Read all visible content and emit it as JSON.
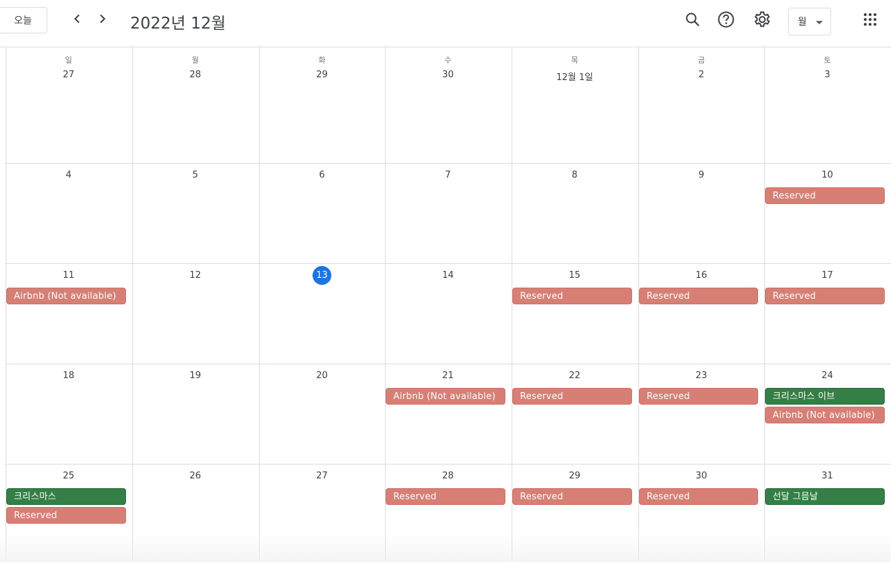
{
  "header": {
    "today_label": "오늘",
    "title": "2022년 12월",
    "view_label": "월"
  },
  "icons": {
    "prev": "chevron-left-icon",
    "next": "chevron-right-icon",
    "search": "search-icon",
    "help": "help-icon",
    "settings": "gear-icon",
    "apps": "apps-grid-icon"
  },
  "colors": {
    "reserved": "#d77f74",
    "holiday": "#337f45",
    "today": "#1a73e8"
  },
  "weekdays": [
    "일",
    "월",
    "화",
    "수",
    "목",
    "금",
    "토"
  ],
  "weeks": [
    {
      "days": [
        "27",
        "28",
        "29",
        "30",
        "12월 1일",
        "2",
        "3"
      ]
    },
    {
      "days": [
        "4",
        "5",
        "6",
        "7",
        "8",
        "9",
        "10"
      ]
    },
    {
      "days": [
        "11",
        "12",
        "13",
        "14",
        "15",
        "16",
        "17"
      ]
    },
    {
      "days": [
        "18",
        "19",
        "20",
        "21",
        "22",
        "23",
        "24"
      ]
    },
    {
      "days": [
        "25",
        "26",
        "27",
        "28",
        "29",
        "30",
        "31"
      ]
    }
  ],
  "today_date": "13",
  "events": [
    {
      "week": 1,
      "day": 6,
      "slot": 0,
      "label": "Reserved",
      "kind": "reserved"
    },
    {
      "week": 2,
      "day": 0,
      "slot": 0,
      "label": "Airbnb (Not available)",
      "kind": "reserved"
    },
    {
      "week": 2,
      "day": 4,
      "slot": 0,
      "label": "Reserved",
      "kind": "reserved"
    },
    {
      "week": 2,
      "day": 5,
      "slot": 0,
      "label": "Reserved",
      "kind": "reserved"
    },
    {
      "week": 2,
      "day": 6,
      "slot": 0,
      "label": "Reserved",
      "kind": "reserved"
    },
    {
      "week": 3,
      "day": 3,
      "slot": 0,
      "label": "Airbnb (Not available)",
      "kind": "reserved"
    },
    {
      "week": 3,
      "day": 4,
      "slot": 0,
      "label": "Reserved",
      "kind": "reserved"
    },
    {
      "week": 3,
      "day": 5,
      "slot": 0,
      "label": "Reserved",
      "kind": "reserved"
    },
    {
      "week": 3,
      "day": 6,
      "slot": 0,
      "label": "크리스마스 이브",
      "kind": "holiday"
    },
    {
      "week": 3,
      "day": 6,
      "slot": 1,
      "label": "Airbnb (Not available)",
      "kind": "reserved"
    },
    {
      "week": 4,
      "day": 0,
      "slot": 0,
      "label": "크리스마스",
      "kind": "holiday"
    },
    {
      "week": 4,
      "day": 0,
      "slot": 1,
      "label": "Reserved",
      "kind": "reserved"
    },
    {
      "week": 4,
      "day": 3,
      "slot": 0,
      "label": "Reserved",
      "kind": "reserved"
    },
    {
      "week": 4,
      "day": 4,
      "slot": 0,
      "label": "Reserved",
      "kind": "reserved"
    },
    {
      "week": 4,
      "day": 5,
      "slot": 0,
      "label": "Reserved",
      "kind": "reserved"
    },
    {
      "week": 4,
      "day": 6,
      "slot": 0,
      "label": "선달 그믐날",
      "kind": "holiday"
    }
  ]
}
